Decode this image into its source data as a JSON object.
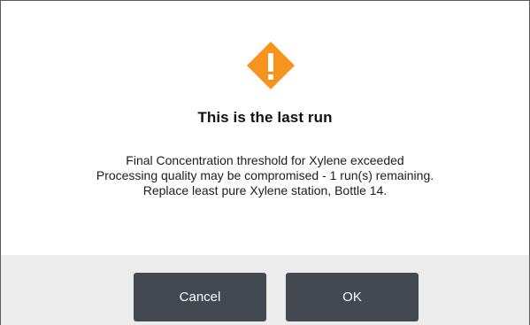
{
  "dialog": {
    "icon": "warning-icon",
    "icon_color": "#f7941d",
    "title": "This is the last run",
    "message_lines": [
      "Final Concentration threshold for Xylene exceeded",
      "Processing quality may be compromised - 1 run(s) remaining.",
      "Replace least pure Xylene station, Bottle 14."
    ]
  },
  "buttons": {
    "cancel_label": "Cancel",
    "ok_label": "OK",
    "button_color": "#444951"
  }
}
